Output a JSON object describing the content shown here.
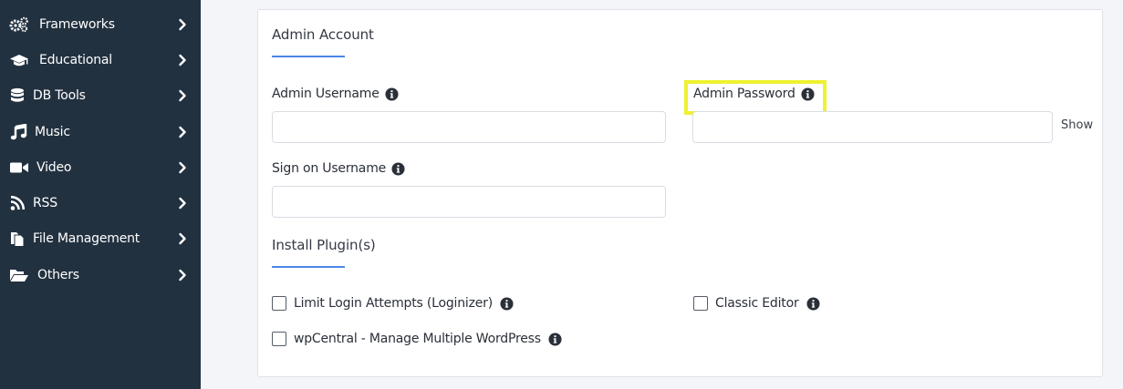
{
  "sidebar": {
    "items": [
      {
        "label": "Frameworks",
        "icon": "cogs-icon"
      },
      {
        "label": "Educational",
        "icon": "graduation-cap-icon"
      },
      {
        "label": "DB Tools",
        "icon": "database-icon"
      },
      {
        "label": "Music",
        "icon": "music-icon"
      },
      {
        "label": "Video",
        "icon": "video-camera-icon"
      },
      {
        "label": "RSS",
        "icon": "rss-icon"
      },
      {
        "label": "File Management",
        "icon": "files-icon"
      },
      {
        "label": "Others",
        "icon": "folder-open-icon"
      }
    ]
  },
  "admin_account": {
    "title": "Admin Account",
    "username_label": "Admin Username",
    "username_value": "",
    "password_label": "Admin Password",
    "password_value": "",
    "show_label": "Show",
    "sign_on_label": "Sign on Username",
    "sign_on_value": ""
  },
  "plugins": {
    "title": "Install Plugin(s)",
    "items": [
      {
        "label": "Limit Login Attempts (Loginizer)",
        "checked": false
      },
      {
        "label": "Classic Editor",
        "checked": false
      },
      {
        "label": "wpCentral - Manage Multiple WordPress",
        "checked": false
      }
    ]
  },
  "colors": {
    "sidebar_bg": "#223140",
    "accent": "#4d86e8",
    "highlight": "#eef231"
  }
}
